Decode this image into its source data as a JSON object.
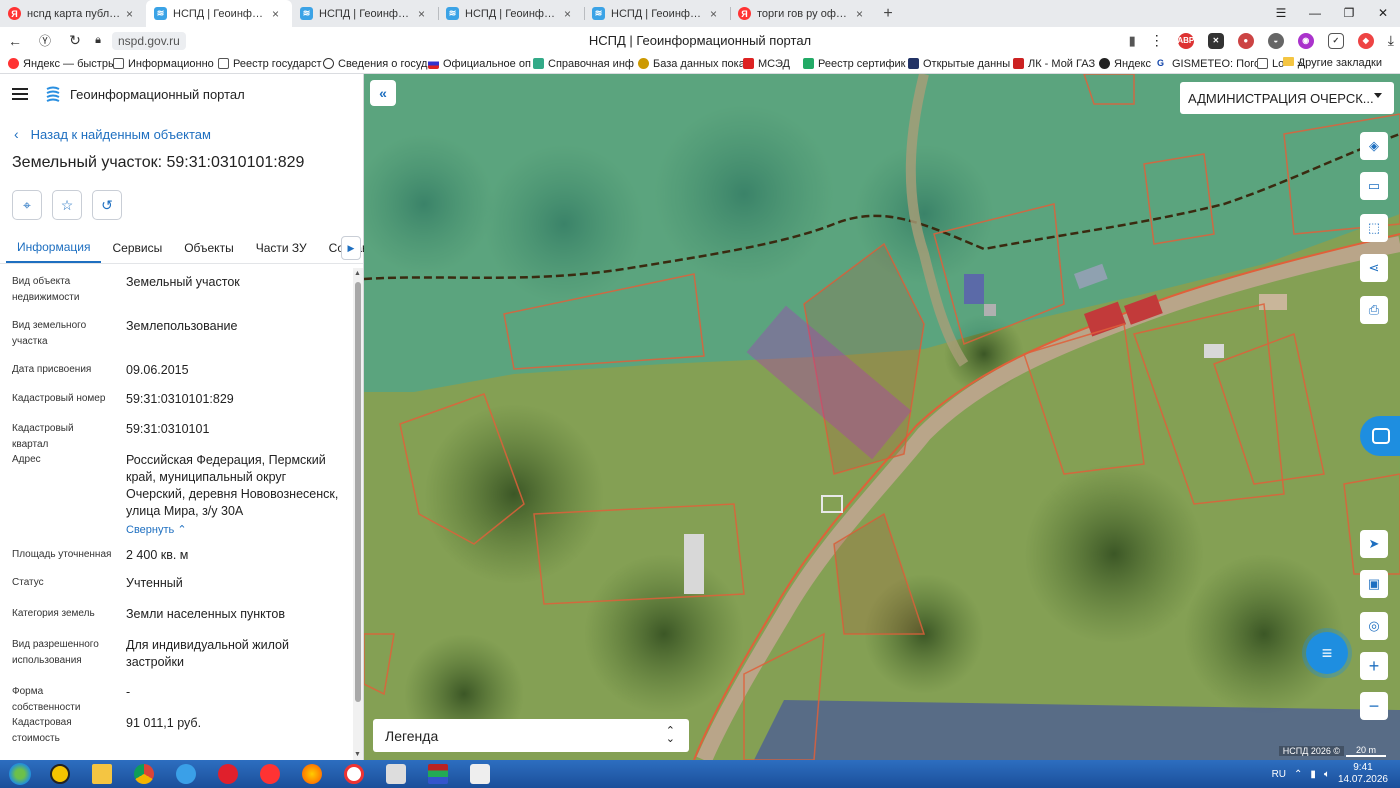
{
  "browser": {
    "tabs": [
      {
        "title": "нсnд карта публичная ка",
        "icon": "yandex-icon",
        "active": false
      },
      {
        "title": "НСПД | Геоинформаци",
        "icon": "nspd-icon",
        "active": true
      },
      {
        "title": "НСПД | Геоинформацион",
        "icon": "nspd-icon",
        "active": false
      },
      {
        "title": "НСПД | Геоинформацион",
        "icon": "nspd-icon",
        "active": false
      },
      {
        "title": "НСПД | Геоинформацион",
        "icon": "nspd-icon",
        "active": false
      },
      {
        "title": "торги гов ру официальные",
        "icon": "yandex-icon",
        "active": false
      }
    ],
    "url": "nspd.gov.ru",
    "page_title": "НСПД | Геоинформационный портал",
    "bookmarks": [
      "Яндекс — быстрый",
      "Информационно",
      "Реестр государст",
      "Сведения о госуд",
      "Официальное оп",
      "Справочная инф",
      "База данных пока",
      "МСЭД",
      "Реестр сертифик",
      "Открытые данны",
      "ЛК - Мой ГАЗ",
      "Яндекс",
      "GISMETEO: Погод",
      "Lo"
    ],
    "other_bookmarks": "Другие закладки",
    "more_bookmarks": "»"
  },
  "panel": {
    "portal_name": "Геоинформационный портал",
    "back_link": "Назад к найденным объектам",
    "object_title": "Земельный участок: 59:31:0310101:829",
    "tabs": [
      "Информация",
      "Сервисы",
      "Объекты",
      "Части ЗУ",
      "Состав"
    ],
    "collapse_label": "Свернуть",
    "fields": [
      {
        "label": "Вид объекта недвижимости",
        "value": "Земельный участок"
      },
      {
        "label": "Вид земельного участка",
        "value": "Землепользование"
      },
      {
        "label": "Дата присвоения",
        "value": "09.06.2015"
      },
      {
        "label": "Кадастровый номер",
        "value": "59:31:0310101:829"
      },
      {
        "label": "Кадастровый квартал",
        "value": "59:31:0310101"
      },
      {
        "label": "Адрес",
        "value": "Российская Федерация, Пермский край, муниципальный округ Очерский, деревня Нововознесенск, улица Мира, з/у 30А"
      },
      {
        "label": "Площадь уточненная",
        "value": "2 400 кв. м"
      },
      {
        "label": "Статус",
        "value": "Учтенный"
      },
      {
        "label": "Категория земель",
        "value": "Земли населенных пунктов"
      },
      {
        "label": "Вид разрешенного использования",
        "value": "Для индивидуальной жилой застройки"
      },
      {
        "label": "Форма собственности",
        "value": "-"
      },
      {
        "label": "Кадастровая стоимость",
        "value": "91 011,1 руб."
      }
    ]
  },
  "map": {
    "region_select": "АДМИНИСТРАЦИЯ ОЧЕРСК...",
    "legend_label": "Легенда",
    "copyright": "НСПД 2026 ©",
    "scale": "20 m",
    "tools": [
      "layers-icon",
      "ruler-icon",
      "select-area-icon",
      "share-icon",
      "print-icon",
      "navigate-icon",
      "minimap-icon",
      "locate-icon",
      "zoom-in-icon",
      "zoom-out-icon"
    ]
  },
  "taskbar": {
    "lang": "RU",
    "time": "9:41",
    "date": "14.07.2026"
  },
  "colors": {
    "accent": "#1e6fc0",
    "selected_parcel": "#b030c0",
    "parcel_outline": "#e0603a",
    "zone_teal": "#3aa8a0"
  }
}
